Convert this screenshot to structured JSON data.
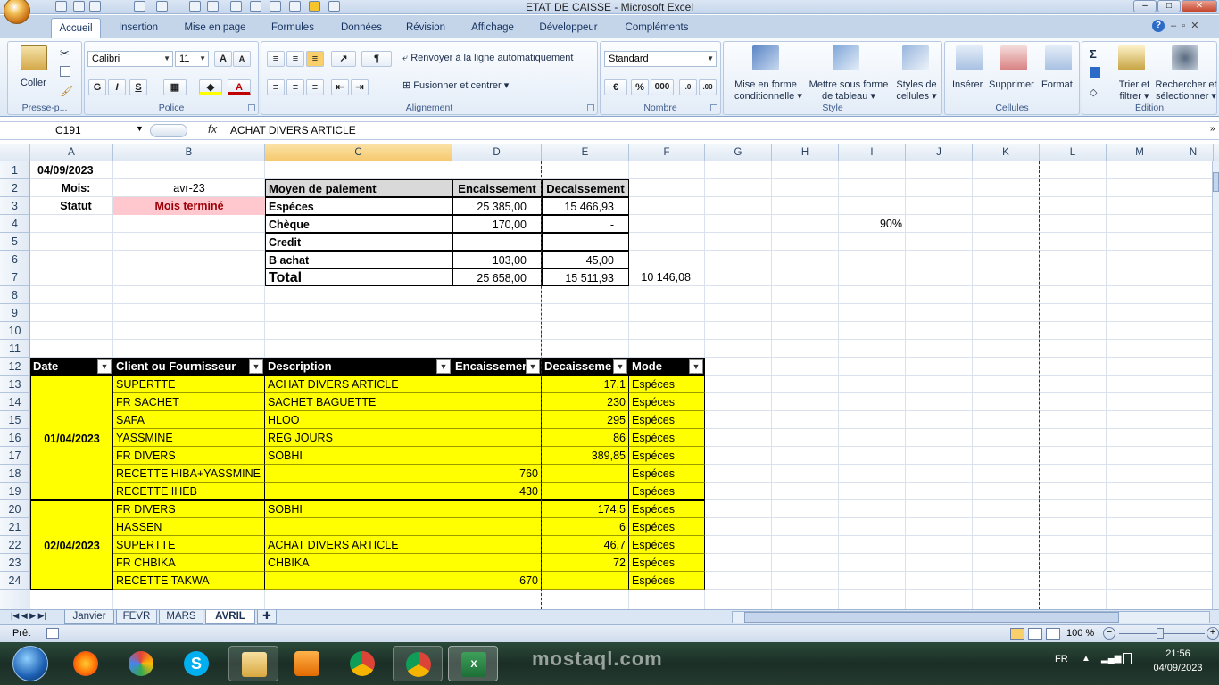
{
  "window": {
    "title": "ETAT DE CAISSE - Microsoft Excel"
  },
  "ribbon_tabs": [
    "Accueil",
    "Insertion",
    "Mise en page",
    "Formules",
    "Données",
    "Révision",
    "Affichage",
    "Développeur",
    "Compléments"
  ],
  "ribbon": {
    "clipboard": {
      "paste": "Coller",
      "label": "Presse-p..."
    },
    "font": {
      "name": "Calibri",
      "size": "11",
      "bold": "G",
      "italic": "I",
      "underline": "S",
      "label": "Police"
    },
    "alignment": {
      "wrap": "Renvoyer à la ligne automatiquement",
      "merge": "Fusionner et centrer",
      "label": "Alignement"
    },
    "number": {
      "format": "Standard",
      "percent": "%",
      "thousands": "000",
      "label": "Nombre"
    },
    "style": {
      "cond1": "Mise en forme",
      "cond2": "conditionnelle",
      "table1": "Mettre sous forme",
      "table2": "de tableau",
      "cell1": "Styles de",
      "cell2": "cellules",
      "label": "Style"
    },
    "cells": {
      "insert": "Insérer",
      "delete": "Supprimer",
      "format": "Format",
      "label": "Cellules"
    },
    "editing": {
      "sort1": "Trier et",
      "sort2": "filtrer",
      "find1": "Rechercher et",
      "find2": "sélectionner",
      "label": "Édition"
    }
  },
  "formula_bar": {
    "cell_ref": "C191",
    "fx": "fx",
    "value": "ACHAT DIVERS ARTICLE"
  },
  "columns": [
    "A",
    "B",
    "C",
    "D",
    "E",
    "F",
    "G",
    "H",
    "I",
    "J",
    "K",
    "L",
    "M",
    "N"
  ],
  "rows": [
    "1",
    "2",
    "3",
    "4",
    "5",
    "6",
    "7",
    "8",
    "9",
    "10",
    "11",
    "12",
    "13",
    "14",
    "15",
    "16",
    "17",
    "18",
    "19",
    "20",
    "21",
    "22",
    "23",
    "24"
  ],
  "sheet": {
    "date": "04/09/2023",
    "mois_label": "Mois:",
    "mois_value": "avr-23",
    "statut_label": "Statut",
    "statut_value": "Mois terminé",
    "percent": "90%",
    "summary": {
      "headers": [
        "Moyen de paiement",
        "Encaissement",
        "Decaissement"
      ],
      "rows": [
        [
          "Espéces",
          "25 385,00",
          "15 466,93"
        ],
        [
          "Chèque",
          "170,00",
          "-"
        ],
        [
          "Credit",
          "-",
          "-"
        ],
        [
          "B achat",
          "103,00",
          "45,00"
        ]
      ],
      "total": [
        "Total",
        "25 658,00",
        "15 511,93"
      ],
      "extra": "10 146,08"
    },
    "table": {
      "headers": [
        "Date",
        "Client ou Fournisseur",
        "Description",
        "Encaissemen",
        "Decaisseme",
        "Mode"
      ],
      "date_groups": [
        {
          "date": "01/04/2023"
        },
        {
          "date": "02/04/2023"
        }
      ],
      "rows": [
        [
          "SUPERTTE",
          "ACHAT DIVERS ARTICLE",
          "",
          "17,1",
          "Espéces"
        ],
        [
          "FR SACHET",
          "SACHET BAGUETTE",
          "",
          "230",
          "Espéces"
        ],
        [
          "SAFA",
          "HLOO",
          "",
          "295",
          "Espéces"
        ],
        [
          "YASSMINE",
          "REG JOURS",
          "",
          "86",
          "Espéces"
        ],
        [
          "FR DIVERS",
          "SOBHI",
          "",
          "389,85",
          "Espéces"
        ],
        [
          "RECETTE HIBA+YASSMINE",
          "",
          "760",
          "",
          "Espéces"
        ],
        [
          "RECETTE IHEB",
          "",
          "430",
          "",
          "Espéces"
        ],
        [
          "FR DIVERS",
          "SOBHI",
          "",
          "174,5",
          "Espéces"
        ],
        [
          "HASSEN",
          "",
          "",
          "6",
          "Espéces"
        ],
        [
          "SUPERTTE",
          "ACHAT DIVERS ARTICLE",
          "",
          "46,7",
          "Espéces"
        ],
        [
          "FR CHBIKA",
          "CHBIKA",
          "",
          "72",
          "Espéces"
        ],
        [
          "RECETTE TAKWA",
          "",
          "670",
          "",
          "Espéces"
        ]
      ]
    }
  },
  "sheet_tabs": [
    "Janvier",
    "FEVR",
    "MARS",
    "AVRIL"
  ],
  "status": {
    "ready": "Prêt",
    "zoom": "100 %"
  },
  "taskbar": {
    "lang": "FR",
    "time": "21:56",
    "date": "04/09/2023",
    "watermark": "mostaql.com"
  },
  "colors": {
    "yellow": "#ffff00",
    "header_black": "#000000",
    "pink_bg": "#ffc7ce",
    "pink_text": "#9c0006"
  }
}
